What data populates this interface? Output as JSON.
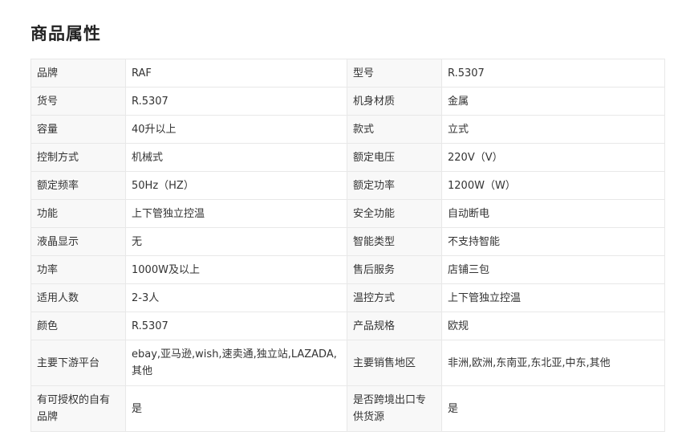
{
  "section_title": "商品属性",
  "rows": [
    {
      "k1": "品牌",
      "v1": "RAF",
      "k2": "型号",
      "v2": "R.5307"
    },
    {
      "k1": "货号",
      "v1": "R.5307",
      "k2": "机身材质",
      "v2": "金属"
    },
    {
      "k1": "容量",
      "v1": "40升以上",
      "k2": "款式",
      "v2": "立式"
    },
    {
      "k1": "控制方式",
      "v1": "机械式",
      "k2": "额定电压",
      "v2": "220V（V）"
    },
    {
      "k1": "额定频率",
      "v1": "50Hz（HZ）",
      "k2": "额定功率",
      "v2": "1200W（W）"
    },
    {
      "k1": "功能",
      "v1": "上下管独立控温",
      "k2": "安全功能",
      "v2": "自动断电"
    },
    {
      "k1": "液晶显示",
      "v1": "无",
      "k2": "智能类型",
      "v2": "不支持智能"
    },
    {
      "k1": "功率",
      "v1": "1000W及以上",
      "k2": "售后服务",
      "v2": "店铺三包"
    },
    {
      "k1": "适用人数",
      "v1": "2-3人",
      "k2": "温控方式",
      "v2": "上下管独立控温"
    },
    {
      "k1": "颜色",
      "v1": "R.5307",
      "k2": "产品规格",
      "v2": "欧规"
    },
    {
      "k1": "主要下游平台",
      "v1": "ebay,亚马逊,wish,速卖通,独立站,LAZADA,其他",
      "k2": "主要销售地区",
      "v2": "非洲,欧洲,东南亚,东北亚,中东,其他"
    },
    {
      "k1": "有可授权的自有品牌",
      "v1": "是",
      "k2": "是否跨境出口专供货源",
      "v2": "是"
    }
  ]
}
